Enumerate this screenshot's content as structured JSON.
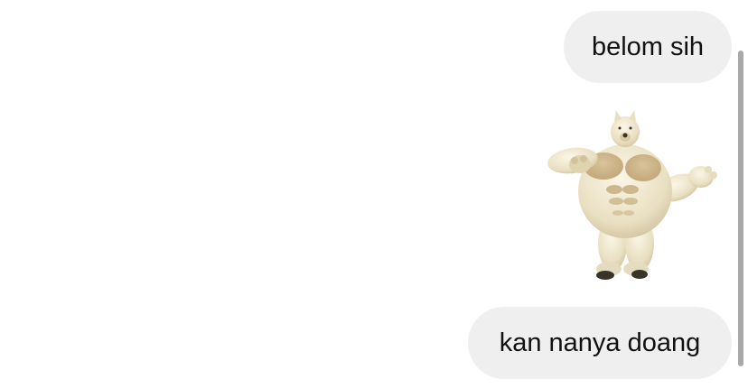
{
  "messages": [
    {
      "text": "belom sih"
    },
    {
      "sticker": "muscular-polar-bear-sticker"
    },
    {
      "text": "kan nanya doang"
    }
  ],
  "colors": {
    "bubble": "#efefef",
    "text": "#111111",
    "scrollbar": "#a9a9a9"
  }
}
